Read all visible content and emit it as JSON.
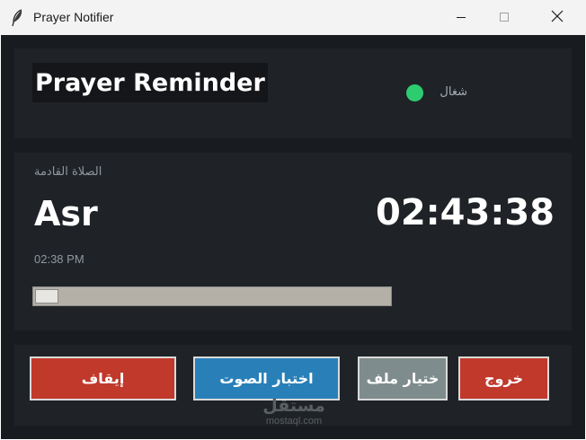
{
  "window": {
    "title": "Prayer Notifier"
  },
  "header": {
    "app_title": "Prayer Reminder",
    "status_label": "شغال",
    "status_color": "#2ecc71"
  },
  "next_prayer": {
    "section_label": "الصلاة القادمة",
    "name": "Asr",
    "time": "02:38 PM",
    "countdown": "02:43:38",
    "progress_fraction": 0.0
  },
  "buttons": {
    "stop": "إيقاف",
    "test_sound": "اختبار الصوت",
    "choose_file": "ختيار ملف",
    "exit": "خروج"
  },
  "watermark": {
    "arabic": "مستقل",
    "latin": "mostaql.com"
  },
  "colors": {
    "background": "#181c20",
    "panel": "#1f2327",
    "danger": "#c0392b",
    "primary": "#2980b9",
    "secondary": "#7f8c8d"
  },
  "icons": {
    "app": "feather-icon",
    "minimize": "minimize-icon",
    "maximize": "maximize-icon",
    "close": "close-icon"
  }
}
